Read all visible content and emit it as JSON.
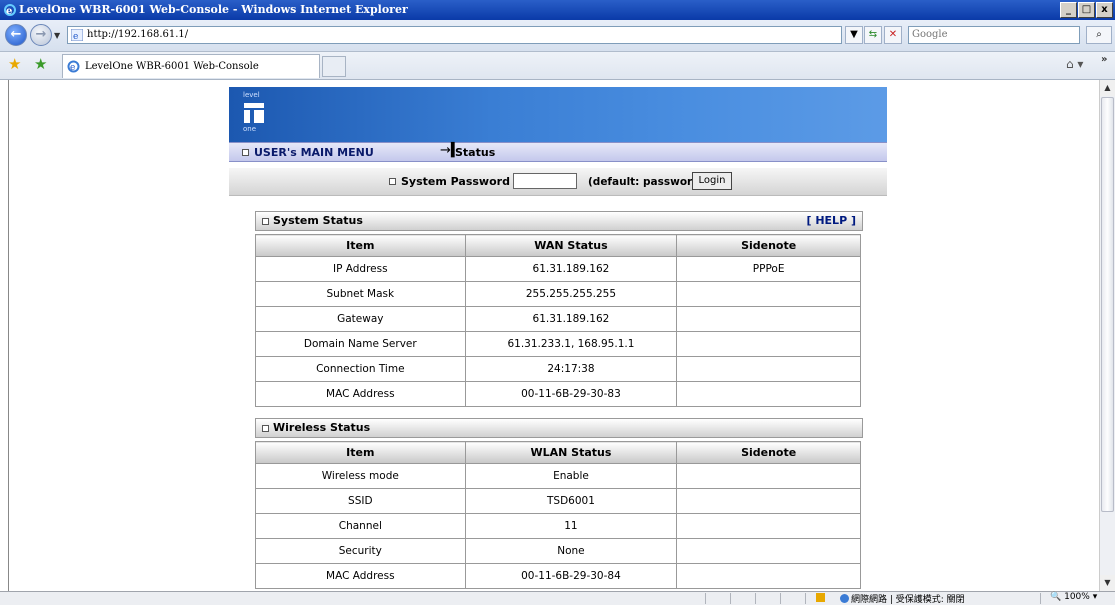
{
  "window": {
    "title": "LevelOne WBR-6001 Web-Console - Windows Internet Explorer"
  },
  "address": {
    "url": "http://192.168.61.1/"
  },
  "search": {
    "placeholder": "Google"
  },
  "tab": {
    "label": "LevelOne WBR-6001 Web-Console"
  },
  "brand": {
    "logo_top": "level",
    "logo_bottom": "one"
  },
  "menu": {
    "main": "USER's MAIN MENU",
    "status": "Status"
  },
  "password": {
    "label": "System Password :",
    "hint": "(default: password)",
    "button": "Login",
    "value": ""
  },
  "system_status": {
    "title": "System Status",
    "help": "[ HELP ]",
    "headers": [
      "Item",
      "WAN Status",
      "Sidenote"
    ],
    "rows": [
      [
        "IP Address",
        "61.31.189.162",
        "PPPoE"
      ],
      [
        "Subnet Mask",
        "255.255.255.255",
        ""
      ],
      [
        "Gateway",
        "61.31.189.162",
        ""
      ],
      [
        "Domain Name Server",
        "61.31.233.1, 168.95.1.1",
        ""
      ],
      [
        "Connection Time",
        "24:17:38",
        ""
      ],
      [
        "MAC Address",
        "00-11-6B-29-30-83",
        ""
      ]
    ]
  },
  "wireless_status": {
    "title": "Wireless Status",
    "headers": [
      "Item",
      "WLAN Status",
      "Sidenote"
    ],
    "rows": [
      [
        "Wireless mode",
        "Enable",
        ""
      ],
      [
        "SSID",
        "TSD6001",
        ""
      ],
      [
        "Channel",
        "11",
        ""
      ],
      [
        "Security",
        "None",
        ""
      ],
      [
        "MAC Address",
        "00-11-6B-29-30-84",
        ""
      ]
    ]
  },
  "statusbar": {
    "zone": "網際網路 | 受保護模式: 關閉",
    "zoom": "100%"
  },
  "colors": {
    "banner": "#2a6cc6",
    "menu_text": "#0a1a6a",
    "help_link": "#001a80"
  }
}
